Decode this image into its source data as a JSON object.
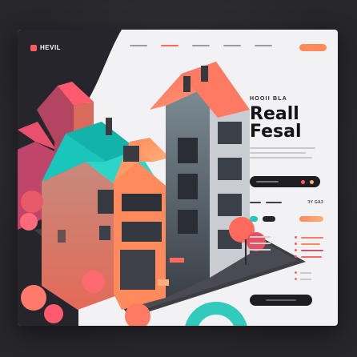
{
  "brand": {
    "name": "HEVIL"
  },
  "hero": {
    "eyebrow": "HOOII BLA",
    "headline_line1": "Reall",
    "headline_line2": "Fesal"
  },
  "nav": {
    "items": [
      "",
      "",
      "",
      "",
      ""
    ]
  },
  "stats": {
    "value": "ꟻY  GA3"
  },
  "colors": {
    "accent": "#ff5a5f",
    "accent_orange": "#ff8a5c",
    "teal": "#1fc9c0",
    "dark": "#1d1d22"
  }
}
